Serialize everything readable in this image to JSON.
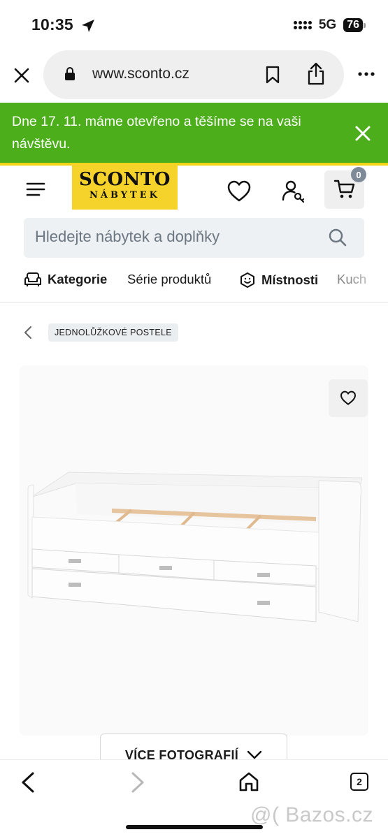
{
  "status_bar": {
    "time": "10:35",
    "network": "5G",
    "battery": "76"
  },
  "browser": {
    "url": "www.sconto.cz",
    "tab_count": "2"
  },
  "banner": {
    "text": "Dne 17. 11. máme otevřeno a těšíme se na vaši návštěvu.",
    "color": "#4cae1a"
  },
  "header": {
    "logo_line1": "SCONTO",
    "logo_line2": "NÁBYTEK",
    "cart_count": "0",
    "brand_color": "#f6d32b"
  },
  "search": {
    "placeholder": "Hledejte nábytek a doplňky"
  },
  "nav": {
    "items": [
      {
        "label": "Kategorie",
        "icon": "sofa-icon"
      },
      {
        "label": "Série produktů"
      },
      {
        "label": "Místnosti",
        "icon": "smiley-icon"
      },
      {
        "label": "Kuch"
      }
    ]
  },
  "breadcrumb": {
    "label": "JEDNOLŮŽKOVÉ POSTELE"
  },
  "product": {
    "more_photos_label": "VÍCE FOTOGRAFIÍ"
  },
  "watermark": "@( Bazos.cz"
}
